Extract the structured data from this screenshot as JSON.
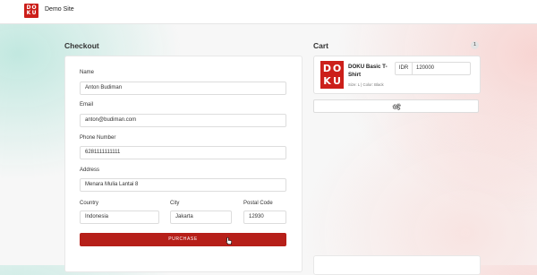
{
  "header": {
    "logo_letters": [
      "D",
      "O",
      "K",
      "U"
    ],
    "site_name": "Demo Site"
  },
  "checkout": {
    "title": "Checkout",
    "fields": {
      "name": {
        "label": "Name",
        "value": "Anton Budiman"
      },
      "email": {
        "label": "Email",
        "value": "anton@budiman.com"
      },
      "phone": {
        "label": "Phone Number",
        "value": "6281111111111"
      },
      "address": {
        "label": "Address",
        "value": "Menara Mulia Lantai 8"
      },
      "country": {
        "label": "Country",
        "value": "Indonesia"
      },
      "city": {
        "label": "City",
        "value": "Jakarta"
      },
      "postal_code": {
        "label": "Postal Code",
        "value": "12930"
      }
    },
    "purchase_label": "PURCHASE"
  },
  "cart": {
    "title": "Cart",
    "count": "1",
    "item": {
      "name": "DOKU Basic T-Shirt",
      "meta": "Size: L | Color: Black",
      "currency": "IDR",
      "price": "120000"
    },
    "settings_icon": "gears-icon"
  },
  "colors": {
    "brand_red": "#cc1f1a",
    "button_red": "#b61f19"
  }
}
